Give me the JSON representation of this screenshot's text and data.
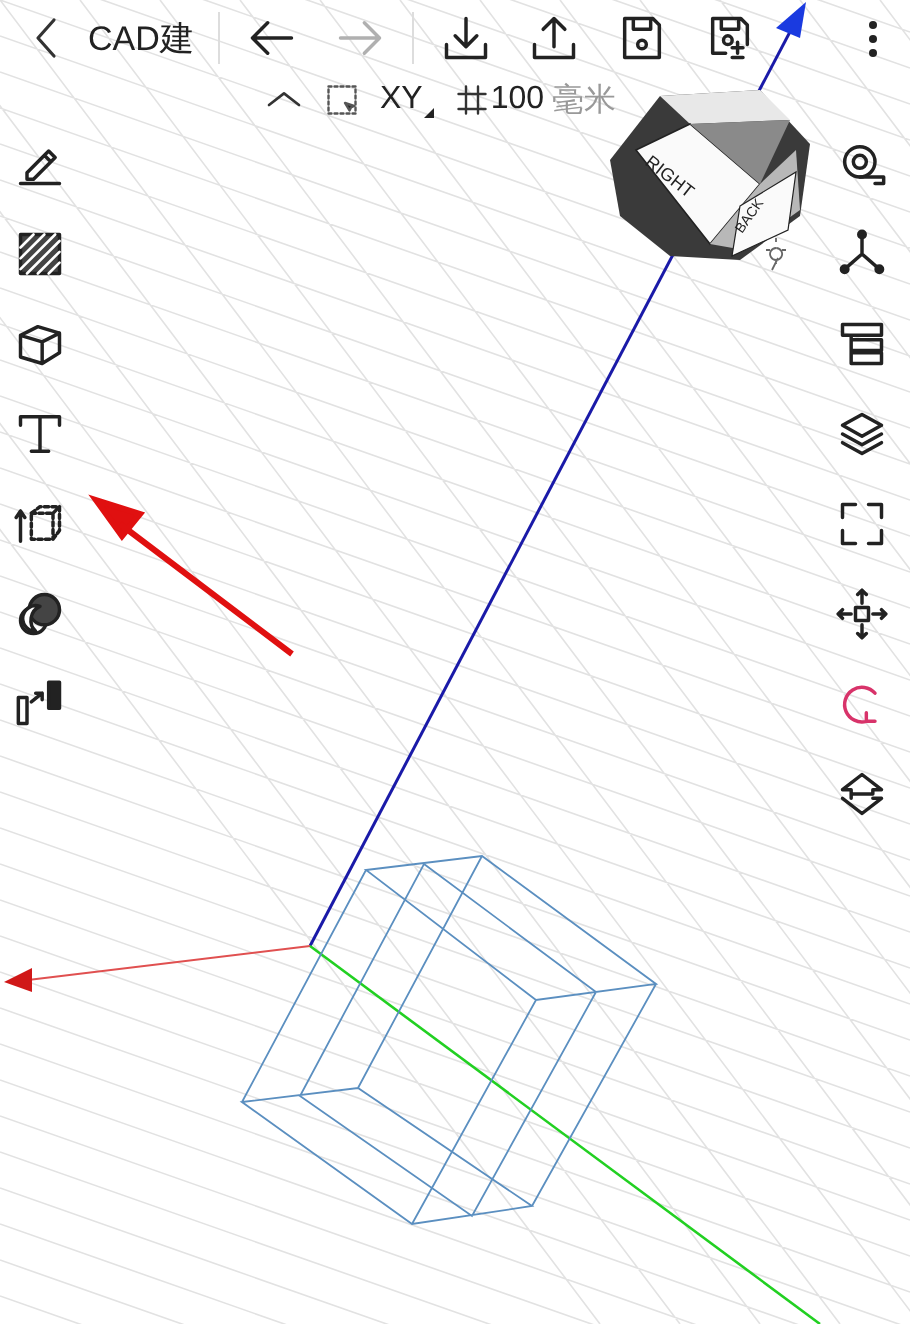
{
  "toolbar": {
    "title": "CAD建",
    "buttons": [
      {
        "kind": "undo",
        "disabled": false
      },
      {
        "kind": "redo",
        "disabled": true
      },
      {
        "kind": "import",
        "disabled": false
      },
      {
        "kind": "export",
        "disabled": false
      },
      {
        "kind": "save",
        "disabled": false
      },
      {
        "kind": "save-as",
        "disabled": false
      }
    ]
  },
  "status": {
    "plane": "XY",
    "grid": "100",
    "unit": "毫米"
  },
  "left_tools": [
    {
      "kind": "sketch"
    },
    {
      "kind": "hatch"
    },
    {
      "kind": "box"
    },
    {
      "kind": "text"
    },
    {
      "kind": "extrude"
    },
    {
      "kind": "boolean"
    },
    {
      "kind": "transfer"
    }
  ],
  "right_tools": [
    {
      "kind": "measure",
      "selected": false
    },
    {
      "kind": "axes",
      "selected": false
    },
    {
      "kind": "tree",
      "selected": false
    },
    {
      "kind": "layers",
      "selected": false
    },
    {
      "kind": "fullscreen",
      "selected": false
    },
    {
      "kind": "move",
      "selected": false
    },
    {
      "kind": "rotate",
      "selected": true
    },
    {
      "kind": "flip",
      "selected": false
    }
  ],
  "view_cube": {
    "faces": [
      "RIGHT",
      "BACK"
    ]
  }
}
